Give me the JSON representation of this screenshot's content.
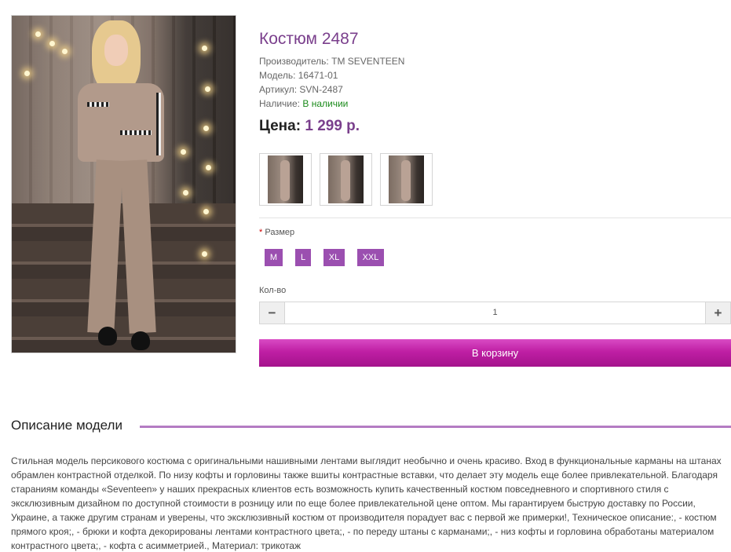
{
  "product": {
    "title": "Костюм 2487",
    "manufacturer_label": "Производитель:",
    "manufacturer_value": "ТМ SEVENTEEN",
    "model_label": "Модель:",
    "model_value": "16471-01",
    "sku_label": "Артикул:",
    "sku_value": "SVN-2487",
    "availability_label": "Наличие:",
    "availability_value": "В наличии",
    "price_label": "Цена:",
    "price_value": "1 299 р."
  },
  "options": {
    "size_label": "Размер",
    "required_mark": "*",
    "sizes": [
      "M",
      "L",
      "XL",
      "XXL"
    ]
  },
  "quantity": {
    "label": "Кол-во",
    "value": "1",
    "minus": "−",
    "plus": "+"
  },
  "cart_button": "В корзину",
  "description": {
    "heading": "Описание модели",
    "text": "Стильная модель персикового костюма с оригинальными нашивными лентами выглядит необычно и очень красиво. Вход в функциональные карманы на штанах обрамлен контрастной отделкой. По низу кофты и горловины также вшиты контрастные вставки, что делает эту модель еще более привлекательной. Благодаря стараниям команды «Seventeen» у наших прекрасных клиентов есть возможность купить качественный костюм повседневного и спортивного стиля с эксклюзивным дизайном по доступной стоимости в розницу или по еще более привлекательной цене оптом. Мы гарантируем быструю доставку по России, Украине, а также другим странам и уверены, что эксклюзивный костюм от производителя порадует вас с первой же примерки!, Техническое описание:, - костюм прямого кроя;, - брюки и кофта декорированы лентами контрастного цвета;, - по переду штаны с карманами;, - низ кофты и горловина обработаны материалом контрастного цвета;, - кофта с асимметрией., Материал: трикотаж"
  },
  "colors": {
    "accent": "#7a3f8c",
    "size_button": "#9b4fb0",
    "cart_button": "#bf1fa4",
    "in_stock": "#1a8a1a"
  }
}
